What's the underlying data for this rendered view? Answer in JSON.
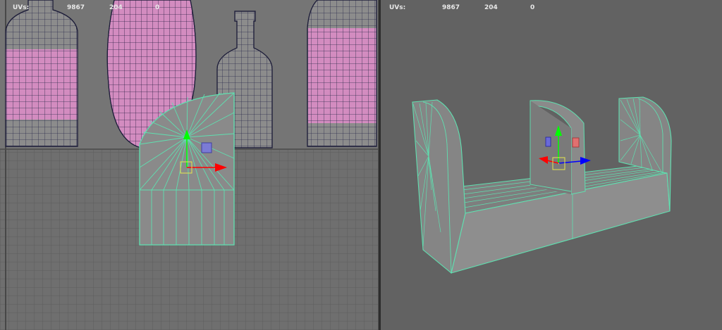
{
  "uv_editor": {
    "hud": {
      "label": "UVs:",
      "count": "9867",
      "selected": "204",
      "extra": "0"
    }
  },
  "perspective_view": {
    "hud": {
      "label": "UVs:",
      "count": "9867",
      "selected": "204",
      "extra": "0"
    }
  },
  "colors": {
    "wire_selected": "#5fe0b0",
    "wire_default": "#1e1e3a",
    "uv_label_fill": "#d38cc0",
    "mesh_fill": "#8a8a8a",
    "grid_bg_lower": "#707070",
    "persp_bg": "#626262",
    "axis_x": "#ff0000",
    "axis_y": "#00ff00",
    "axis_z": "#0000ff"
  }
}
